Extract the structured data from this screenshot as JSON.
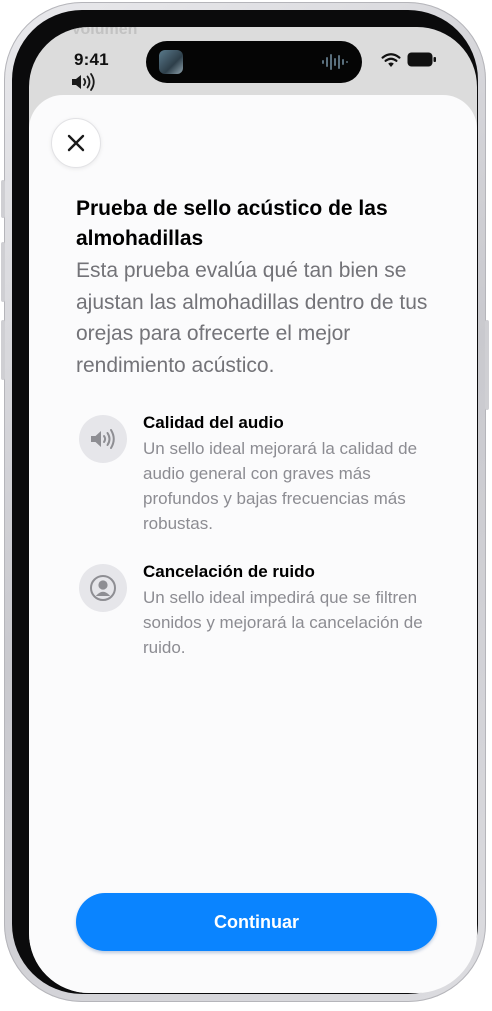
{
  "status_bar": {
    "background_label": "Volumen",
    "time": "9:41"
  },
  "sheet": {
    "title": "Prueba de sello acústico de las almohadillas",
    "subtitle": "Esta prueba evalúa qué tan bien se ajustan las almohadillas dentro de tus orejas para ofrecerte el mejor rendimiento acústico.",
    "features": [
      {
        "icon": "speaker-icon",
        "title": "Calidad del audio",
        "description": "Un sello ideal mejorará la calidad de audio general con graves más profundos y bajas frecuencias más robustas."
      },
      {
        "icon": "person-silhouette-icon",
        "title": "Cancelación de ruido",
        "description": "Un sello ideal impedirá que se filtren sonidos y mejorará la cancelación de ruido."
      }
    ],
    "continue_label": "Continuar"
  },
  "colors": {
    "accent": "#0a84ff",
    "sheet_background": "#fbfbfc",
    "secondary_text": "#737378"
  }
}
